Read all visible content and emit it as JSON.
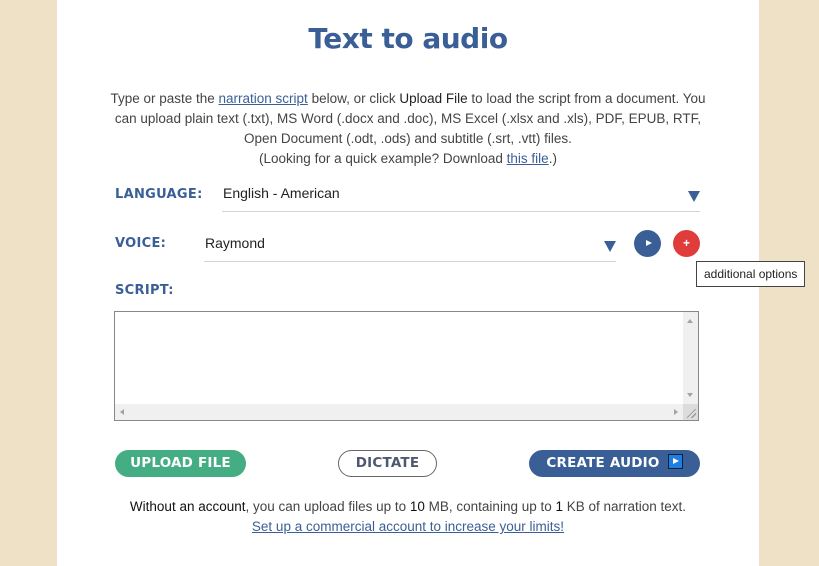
{
  "page": {
    "title": "Text to audio",
    "intro": {
      "part1": "Type or paste the ",
      "link_narration": "narration script",
      "part2": " below, or click ",
      "upload_bold": "Upload File",
      "part3": " to load the script from a document. You can upload plain text (.txt), MS Word (.docx and .doc), MS Excel (.xlsx and .xls), PDF, EPUB, RTF, Open Document (.odt, .ods) and subtitle (.srt, .vtt) files.",
      "part4": "(Looking for a quick example? Download ",
      "link_file": "this file",
      "part5": ".)"
    }
  },
  "form": {
    "language": {
      "label": "LANGUAGE:",
      "value": "English - American"
    },
    "voice": {
      "label": "VOICE:",
      "value": "Raymond"
    },
    "script": {
      "label": "SCRIPT:",
      "value": ""
    },
    "play_button_icon": "play-icon",
    "options_button_icon": "plus-icon",
    "tooltip": "additional options"
  },
  "buttons": {
    "upload": "UPLOAD FILE",
    "dictate": "DICTATE",
    "create": "CREATE AUDIO"
  },
  "limits": {
    "bold1": "Without an account",
    "text1": ", you can upload files up to ",
    "size": "10",
    "text2": " MB, containing up to ",
    "kb": "1",
    "text3": " KB of narration text.",
    "link": "Set up a commercial account to increase your limits!"
  },
  "colors": {
    "brand_blue": "#3a5f96",
    "upload_green": "#44ad84",
    "options_red": "#e03c3c",
    "page_background": "#efe1c6"
  }
}
